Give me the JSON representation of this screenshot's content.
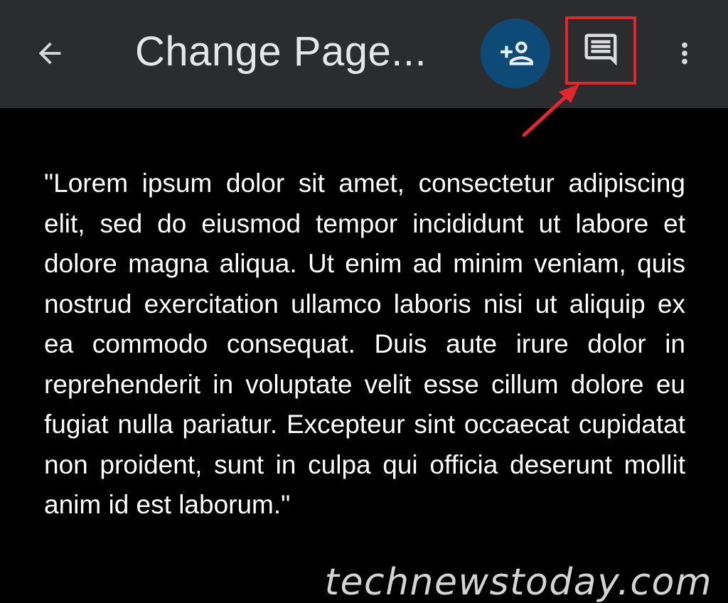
{
  "header": {
    "title": "Change Page...",
    "back_icon": "arrow-back-icon",
    "share_icon": "person-add-icon",
    "comment_icon": "comment-icon",
    "more_icon": "more-vert-icon"
  },
  "colors": {
    "topbar_bg": "#2b2c2e",
    "share_bg": "#0d4a78",
    "annotation": "#e1262e",
    "page_bg": "#000000",
    "text": "#ffffff"
  },
  "document": {
    "body": "\"Lorem ipsum dolor sit amet, consectetur adipiscing elit, sed do eiusmod tempor incididunt ut labore et dolore magna aliqua. Ut enim ad minim veniam, quis nostrud exercitation ullamco laboris nisi ut aliquip ex ea commodo consequat. Duis aute irure dolor in reprehenderit in voluptate velit esse cillum dolore eu fugiat nulla pariatur. Excepteur sint occaecat cupidatat non proident, sunt in culpa qui officia deserunt mollit anim id est laborum.\""
  },
  "watermark": "technewstoday.com"
}
